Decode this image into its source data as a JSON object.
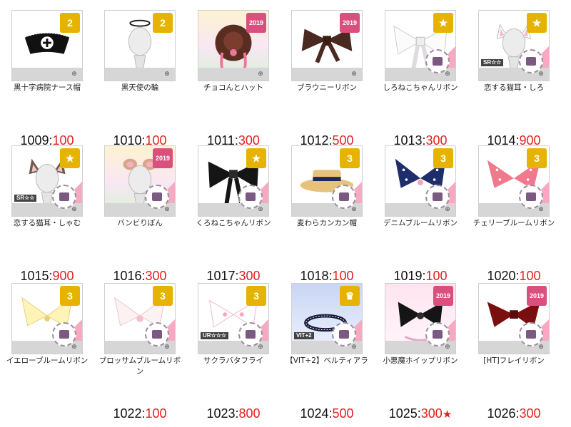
{
  "colors": {
    "price": "#e02020",
    "id": "#111111",
    "badge_gold": "#e6b400",
    "badge_pink": "#d94f7e",
    "zoom_icon": "#555555"
  },
  "items": [
    {
      "name": "黒十字病院ナース帽",
      "id": "1009",
      "price": "100",
      "badge": "2",
      "rank": "",
      "art": "nurse-cap-art",
      "theme": "plain"
    },
    {
      "name": "黒天使の輪",
      "id": "1010",
      "price": "100",
      "badge": "2",
      "rank": "",
      "art": "halo-art",
      "theme": "plain"
    },
    {
      "name": "チョコんとハット",
      "id": "1011",
      "price": "300",
      "badge": "2019",
      "rank": "",
      "art": "choco-hat-art",
      "theme": "rainbow"
    },
    {
      "name": "ブラウニーリボン",
      "id": "1012",
      "price": "500",
      "badge": "2019",
      "rank": "",
      "art": "brown-ribbon-art",
      "theme": "plain"
    },
    {
      "name": "しろねこちゃんリボン",
      "id": "1013",
      "price": "300",
      "badge": "★",
      "rank": "",
      "art": "white-ribbon-art",
      "theme": "plain"
    },
    {
      "name": "恋する猫耳・しろ",
      "id": "1014",
      "price": "900",
      "badge": "★",
      "rank": "SR☆☆",
      "art": "white-cat-ears-art",
      "theme": "plain"
    },
    {
      "name": "恋する猫耳・しゃむ",
      "id": "1015",
      "price": "900",
      "badge": "★",
      "rank": "SR☆☆",
      "art": "siamese-cat-ears-art",
      "theme": "plain"
    },
    {
      "name": "バンビりぼん",
      "id": "1016",
      "price": "300",
      "badge": "2019",
      "rank": "",
      "art": "bambi-ribbon-art",
      "theme": "rainbow"
    },
    {
      "name": "くろねこちゃんリボン",
      "id": "1017",
      "price": "300",
      "badge": "★",
      "rank": "",
      "art": "black-ribbon-art",
      "theme": "plain"
    },
    {
      "name": "麦わらカンカン帽",
      "id": "1018",
      "price": "100",
      "badge": "3",
      "rank": "",
      "art": "straw-hat-art",
      "theme": "plain"
    },
    {
      "name": "デニムブルームリボン",
      "id": "1019",
      "price": "100",
      "badge": "3",
      "rank": "",
      "art": "denim-ribbon-art",
      "theme": "plain"
    },
    {
      "name": "チェリーブルームリボン",
      "id": "1020",
      "price": "100",
      "badge": "3",
      "rank": "",
      "art": "cherry-ribbon-art",
      "theme": "plain"
    },
    {
      "name": "イエローブルームリボン",
      "id": "",
      "price": "",
      "badge": "3",
      "rank": "",
      "art": "yellow-ribbon-art",
      "theme": "plain"
    },
    {
      "name": "ブロッサムブルームリボン",
      "id": "1022",
      "price": "100",
      "badge": "3",
      "rank": "",
      "art": "blossom-ribbon-art",
      "theme": "plain"
    },
    {
      "name": "サクラバタフライ",
      "id": "1023",
      "price": "800",
      "badge": "3",
      "rank": "UR☆☆☆",
      "art": "sakura-butterfly-art",
      "theme": "plain"
    },
    {
      "name": "【VIT+2】ベルティアラ",
      "id": "1024",
      "price": "500",
      "badge": "♛",
      "rank": "VIT+2",
      "art": "bell-tiara-art",
      "theme": "blue"
    },
    {
      "name": "小悪魔ホイップリボン",
      "id": "1025",
      "price": "300",
      "badge": "2019",
      "rank": "",
      "art": "devil-whip-ribbon-art",
      "theme": "pink",
      "star": "★"
    },
    {
      "name": "[HT]フレイリボン",
      "id": "1026",
      "price": "300",
      "badge": "2019",
      "rank": "",
      "art": "frey-ribbon-art",
      "theme": "plain"
    }
  ]
}
